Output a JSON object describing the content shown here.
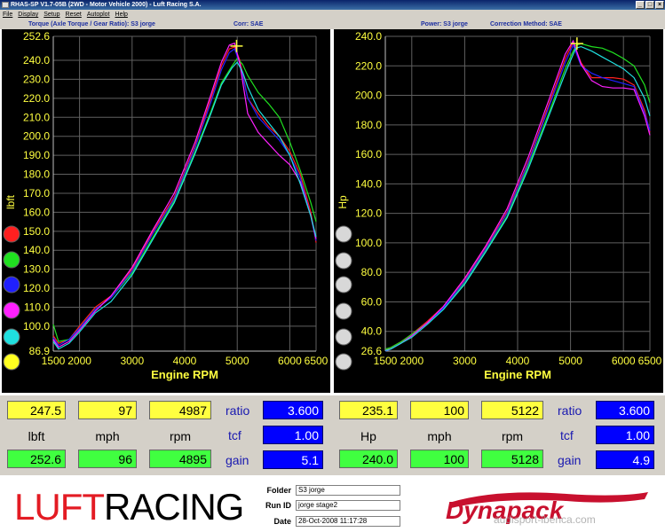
{
  "window": {
    "title": "RHAS-SP V1.7-05B  (2WD - Motor Vehicle 2000) - Luft Racing S.A.",
    "buttons": [
      "_",
      "□",
      "×"
    ]
  },
  "menu": [
    "File",
    "Display",
    "Setup",
    "Reset",
    "Autoplot",
    "Help"
  ],
  "left_header": {
    "title": "Torque (Axle Torque / Gear Ratio): S3 jorge",
    "corr": "Corr: SAE"
  },
  "right_header": {
    "title": "Power: S3 jorge",
    "corr": "Correction Method: SAE"
  },
  "colors": {
    "red": "#ff2020",
    "green": "#20e020",
    "blue": "#2020ff",
    "magenta": "#ff20ff",
    "cyan": "#20e0e0",
    "yellow": "#ffff20",
    "grid": "#606060",
    "tick": "#ffff40",
    "axis_label": "#ffff40"
  },
  "left_knobs": [
    "red",
    "green",
    "blue",
    "magenta",
    "cyan",
    "yellow"
  ],
  "chart_data": [
    {
      "type": "line",
      "title": "Torque (Axle Torque / Gear Ratio): S3 jorge",
      "xlabel": "Engine RPM",
      "ylabel": "lbft",
      "xlim": [
        1500,
        6500
      ],
      "ylim": [
        86.9,
        252.6
      ],
      "xticks": [
        "1500",
        "2000",
        "3000",
        "4000",
        "5000",
        "6000",
        "6500"
      ],
      "yticks": [
        "86.9",
        "100.0",
        "110.0",
        "120.0",
        "130.0",
        "140.0",
        "150.0",
        "160.0",
        "170.0",
        "180.0",
        "190.0",
        "200.0",
        "210.0",
        "220.0",
        "230.0",
        "240.0",
        "252.6"
      ],
      "marker": {
        "x": 4987,
        "y": 247.5
      },
      "series": [
        {
          "color": "red",
          "x": [
            1500,
            1600,
            1800,
            2000,
            2300,
            2600,
            3000,
            3400,
            3800,
            4200,
            4500,
            4700,
            4850,
            4950,
            5050,
            5200,
            5400,
            5600,
            5800,
            6000,
            6200,
            6400,
            6500
          ],
          "y": [
            95,
            91,
            93,
            100,
            110,
            116,
            130,
            150,
            168,
            195,
            220,
            237,
            246,
            247,
            240,
            220,
            212,
            205,
            200,
            192,
            180,
            160,
            144
          ]
        },
        {
          "color": "green",
          "x": [
            1500,
            1600,
            1800,
            2000,
            2300,
            2600,
            3000,
            3400,
            3800,
            4200,
            4500,
            4700,
            4900,
            5000,
            5100,
            5200,
            5400,
            5600,
            5800,
            6000,
            6200,
            6400,
            6500
          ],
          "y": [
            101,
            92,
            93,
            99,
            109,
            115,
            128,
            147,
            166,
            192,
            213,
            228,
            237,
            241,
            238,
            232,
            223,
            217,
            210,
            197,
            182,
            165,
            155
          ]
        },
        {
          "color": "blue",
          "x": [
            1500,
            1600,
            1800,
            2000,
            2300,
            2600,
            3000,
            3400,
            3800,
            4200,
            4500,
            4700,
            4850,
            4950,
            5050,
            5200,
            5400,
            5600,
            5800,
            6000,
            6200,
            6400,
            6500
          ],
          "y": [
            94,
            90,
            93,
            99,
            109,
            115,
            129,
            149,
            167,
            194,
            218,
            235,
            244,
            246,
            238,
            220,
            210,
            204,
            198,
            190,
            178,
            158,
            145
          ]
        },
        {
          "color": "magenta",
          "x": [
            1500,
            1600,
            1800,
            2000,
            2300,
            2600,
            3000,
            3400,
            3800,
            4200,
            4500,
            4700,
            4850,
            4950,
            5050,
            5200,
            5400,
            5600,
            5800,
            6000,
            6200,
            6400,
            6500
          ],
          "y": [
            93,
            89,
            92,
            98,
            108,
            116,
            131,
            151,
            170,
            197,
            222,
            239,
            248,
            249,
            238,
            212,
            202,
            196,
            190,
            185,
            176,
            158,
            146
          ]
        },
        {
          "color": "cyan",
          "x": [
            1500,
            1600,
            1800,
            2000,
            2300,
            2600,
            3000,
            3400,
            3800,
            4200,
            4500,
            4700,
            4900,
            5000,
            5100,
            5200,
            5400,
            5600,
            5800,
            6000,
            6200,
            6400,
            6500
          ],
          "y": [
            92,
            88,
            91,
            97,
            107,
            113,
            127,
            146,
            165,
            191,
            212,
            227,
            236,
            239,
            234,
            226,
            214,
            207,
            200,
            190,
            175,
            158,
            147
          ]
        }
      ]
    },
    {
      "type": "line",
      "title": "Power: S3 jorge",
      "xlabel": "Engine RPM",
      "ylabel": "Hp",
      "xlim": [
        1500,
        6500
      ],
      "ylim": [
        26.6,
        240.0
      ],
      "xticks": [
        "1500",
        "2000",
        "3000",
        "4000",
        "5000",
        "6000",
        "6500"
      ],
      "yticks": [
        "26.6",
        "40.0",
        "60.0",
        "80.0",
        "100.0",
        "120.0",
        "140.0",
        "160.0",
        "180.0",
        "200.0",
        "220.0",
        "240.0"
      ],
      "marker": {
        "x": 5122,
        "y": 235.1
      },
      "series": [
        {
          "color": "red",
          "x": [
            1500,
            1600,
            1800,
            2000,
            2300,
            2600,
            3000,
            3400,
            3800,
            4200,
            4600,
            4900,
            5050,
            5200,
            5400,
            5600,
            5800,
            6000,
            6200,
            6400,
            6500
          ],
          "y": [
            27,
            29,
            33,
            38,
            47,
            57,
            75,
            97,
            121,
            155,
            195,
            225,
            236,
            222,
            212,
            212,
            212,
            211,
            207,
            190,
            175
          ]
        },
        {
          "color": "green",
          "x": [
            1500,
            1600,
            1800,
            2000,
            2300,
            2600,
            3000,
            3400,
            3800,
            4200,
            4600,
            4900,
            5100,
            5200,
            5400,
            5600,
            5800,
            6000,
            6200,
            6400,
            6500
          ],
          "y": [
            28,
            29,
            33,
            38,
            46,
            56,
            73,
            95,
            118,
            152,
            189,
            218,
            234,
            235,
            233,
            232,
            229,
            225,
            220,
            207,
            195
          ]
        },
        {
          "color": "blue",
          "x": [
            1500,
            1600,
            1800,
            2000,
            2300,
            2600,
            3000,
            3400,
            3800,
            4200,
            4600,
            4900,
            5050,
            5200,
            5400,
            5600,
            5800,
            6000,
            6200,
            6400,
            6500
          ],
          "y": [
            26.6,
            28,
            32,
            37,
            46,
            56,
            74,
            96,
            120,
            154,
            193,
            222,
            234,
            220,
            215,
            212,
            210,
            208,
            206,
            188,
            176
          ]
        },
        {
          "color": "magenta",
          "x": [
            1500,
            1600,
            1800,
            2000,
            2300,
            2600,
            3000,
            3400,
            3800,
            4200,
            4600,
            4900,
            5050,
            5200,
            5400,
            5600,
            5800,
            6000,
            6200,
            6400,
            6500
          ],
          "y": [
            27,
            28,
            32,
            37,
            46,
            57,
            76,
            98,
            123,
            158,
            198,
            228,
            237,
            221,
            210,
            206,
            205,
            205,
            204,
            186,
            173
          ]
        },
        {
          "color": "cyan",
          "x": [
            1500,
            1600,
            1800,
            2000,
            2300,
            2600,
            3000,
            3400,
            3800,
            4200,
            4600,
            4900,
            5100,
            5200,
            5400,
            5600,
            5800,
            6000,
            6200,
            6400,
            6500
          ],
          "y": [
            27,
            28,
            32,
            36,
            45,
            55,
            72,
            94,
            117,
            150,
            187,
            215,
            232,
            233,
            230,
            226,
            222,
            218,
            212,
            198,
            186
          ]
        }
      ]
    }
  ],
  "left_readout": {
    "top": [
      "247.5",
      "97",
      "4987"
    ],
    "units": [
      "lbft",
      "mph",
      "rpm"
    ],
    "bottom": [
      "252.6",
      "96",
      "4895"
    ],
    "labels": [
      "ratio",
      "tcf",
      "gain"
    ],
    "params": [
      "3.600",
      "1.00",
      "5.1"
    ]
  },
  "right_readout": {
    "top": [
      "235.1",
      "100",
      "5122"
    ],
    "units": [
      "Hp",
      "mph",
      "rpm"
    ],
    "bottom": [
      "240.0",
      "100",
      "5128"
    ],
    "labels": [
      "ratio",
      "tcf",
      "gain"
    ],
    "params": [
      "3.600",
      "1.00",
      "4.9"
    ]
  },
  "footer": {
    "logo_left": [
      "LUFT",
      "RACING"
    ],
    "folder_label": "Folder",
    "folder_value": "S3 jorge",
    "runid_label": "Run ID",
    "runid_value": "jorge stage2",
    "date_label": "Date",
    "date_value": "28-Oct-2008   11:17:28",
    "logo_right": "Dynapack",
    "watermark": "audisport-iberica.com"
  }
}
